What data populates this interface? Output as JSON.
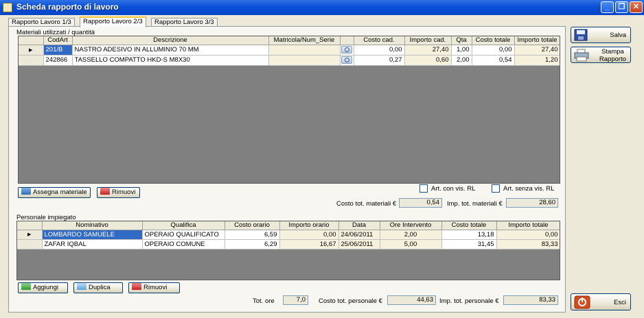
{
  "window": {
    "title": "Scheda rapporto di lavoro"
  },
  "tabs": [
    {
      "label": "Rapporto Lavoro 1/3"
    },
    {
      "label": "Rapporto Lavoro 2/3"
    },
    {
      "label": "Rapporto Lavoro 3/3"
    }
  ],
  "materials": {
    "section_label": "Materiali utilizzati / quantità",
    "columns": [
      "CodArt",
      "Descrizione",
      "Matricola/Num_Serie",
      "",
      "Costo cad.",
      "Importo cad.",
      "Qta",
      "Costo totale",
      "Importo totale"
    ],
    "rows": [
      {
        "cod": "201/B",
        "desc": "NASTRO ADESIVO IN ALLUMINIO 70 MM",
        "matricola": "",
        "costo_cad": "0,00",
        "importo_cad": "27,40",
        "qta": "1,00",
        "costo_tot": "0,00",
        "importo_tot": "27,40"
      },
      {
        "cod": "242866",
        "desc": "TASSELLO COMPATTO HKD-S M8X30",
        "matricola": "",
        "costo_cad": "0,27",
        "importo_cad": "0,60",
        "qta": "2,00",
        "costo_tot": "0,54",
        "importo_tot": "1,20"
      }
    ],
    "assign_btn": "Assegna materiale",
    "remove_btn": "Rimuovi",
    "chk_con": "Art. con vis. RL",
    "chk_senza": "Art. senza vis. RL",
    "costo_tot_label": "Costo tot. materiali €",
    "costo_tot_value": "0,54",
    "imp_tot_label": "Imp. tot. materiali €",
    "imp_tot_value": "28,60"
  },
  "personnel": {
    "section_label": "Personale impiegato",
    "columns": [
      "Nominativo",
      "Qualifica",
      "Costo orario",
      "Importo orario",
      "Data",
      "Ore Intervento",
      "Costo totale",
      "Importo totale"
    ],
    "rows": [
      {
        "nome": "LOMBARDO SAMUELE",
        "qualifica": "OPERAIO QUALIFICATO",
        "costo_orario": "6,59",
        "importo_orario": "0,00",
        "data": "24/06/2011",
        "ore": "2,00",
        "costo_tot": "13,18",
        "importo_tot": "0,00"
      },
      {
        "nome": "ZAFAR IQBAL",
        "qualifica": "OPERAIO COMUNE",
        "costo_orario": "6,29",
        "importo_orario": "16,67",
        "data": "25/06/2011",
        "ore": "5,00",
        "costo_tot": "31,45",
        "importo_tot": "83,33"
      }
    ],
    "add_btn": "Aggiungi",
    "dup_btn": "Duplica",
    "remove_btn": "Rimuovi",
    "tot_ore_label": "Tot. ore",
    "tot_ore_value": "7,0",
    "costo_tot_label": "Costo tot. personale €",
    "costo_tot_value": "44,63",
    "imp_tot_label": "Imp. tot. personale €",
    "imp_tot_value": "83,33"
  },
  "side": {
    "save": "Salva",
    "print_line1": "Stampa",
    "print_line2": "Rapporto",
    "exit": "Esci"
  },
  "icons": [
    "app-icon",
    "minimize-icon",
    "maximize-icon",
    "close-icon",
    "row-pointer-icon",
    "lookup-icon",
    "floppy-icon",
    "printer-icon",
    "exit-icon"
  ]
}
